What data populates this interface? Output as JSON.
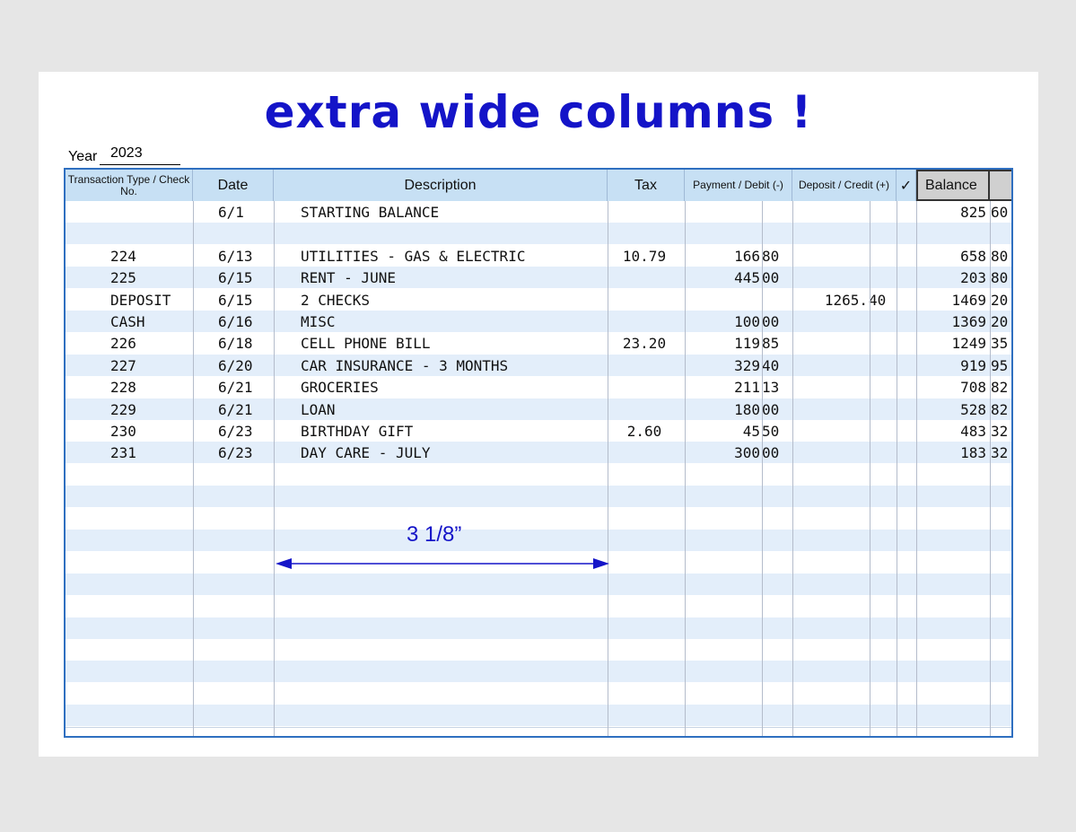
{
  "title": "extra wide columns !",
  "year": {
    "label": "Year",
    "value": "2023"
  },
  "headers": {
    "type": "Transaction Type / Check No.",
    "date": "Date",
    "description": "Description",
    "tax": "Tax",
    "payment": "Payment / Debit (-)",
    "deposit": "Deposit / Credit (+)",
    "check": "✓",
    "balance": "Balance"
  },
  "rows": [
    {
      "type": "",
      "date": "6/1",
      "desc": "STARTING BALANCE",
      "tax": "",
      "pay_d": "",
      "pay_c": "",
      "dep_d": "",
      "dep_c": "",
      "bal_d": "825",
      "bal_c": "60"
    },
    {
      "type": "",
      "date": "",
      "desc": "",
      "tax": "",
      "pay_d": "",
      "pay_c": "",
      "dep_d": "",
      "dep_c": "",
      "bal_d": "",
      "bal_c": ""
    },
    {
      "type": "224",
      "date": "6/13",
      "desc": "UTILITIES - GAS & ELECTRIC",
      "tax": "10.79",
      "pay_d": "166",
      "pay_c": "80",
      "dep_d": "",
      "dep_c": "",
      "bal_d": "658",
      "bal_c": "80"
    },
    {
      "type": "225",
      "date": "6/15",
      "desc": "RENT - JUNE",
      "tax": "",
      "pay_d": "445",
      "pay_c": "00",
      "dep_d": "",
      "dep_c": "",
      "bal_d": "203",
      "bal_c": "80"
    },
    {
      "type": "DEPOSIT",
      "date": "6/15",
      "desc": "2 CHECKS",
      "tax": "",
      "pay_d": "",
      "pay_c": "",
      "dep_d": "1265.",
      "dep_c": "40",
      "bal_d": "1469",
      "bal_c": "20"
    },
    {
      "type": "CASH",
      "date": "6/16",
      "desc": "MISC",
      "tax": "",
      "pay_d": "100",
      "pay_c": "00",
      "dep_d": "",
      "dep_c": "",
      "bal_d": "1369",
      "bal_c": "20"
    },
    {
      "type": "226",
      "date": "6/18",
      "desc": "CELL PHONE BILL",
      "tax": "23.20",
      "pay_d": "119",
      "pay_c": "85",
      "dep_d": "",
      "dep_c": "",
      "bal_d": "1249",
      "bal_c": "35"
    },
    {
      "type": "227",
      "date": "6/20",
      "desc": "CAR INSURANCE - 3 MONTHS",
      "tax": "",
      "pay_d": "329",
      "pay_c": "40",
      "dep_d": "",
      "dep_c": "",
      "bal_d": "919",
      "bal_c": "95"
    },
    {
      "type": "228",
      "date": "6/21",
      "desc": "GROCERIES",
      "tax": "",
      "pay_d": "211",
      "pay_c": "13",
      "dep_d": "",
      "dep_c": "",
      "bal_d": "708",
      "bal_c": "82"
    },
    {
      "type": "229",
      "date": "6/21",
      "desc": "LOAN",
      "tax": "",
      "pay_d": "180",
      "pay_c": "00",
      "dep_d": "",
      "dep_c": "",
      "bal_d": "528",
      "bal_c": "82"
    },
    {
      "type": "230",
      "date": "6/23",
      "desc": "BIRTHDAY GIFT",
      "tax": "2.60",
      "pay_d": "45",
      "pay_c": "50",
      "dep_d": "",
      "dep_c": "",
      "bal_d": "483",
      "bal_c": "32"
    },
    {
      "type": "231",
      "date": "6/23",
      "desc": "DAY CARE - JULY",
      "tax": "",
      "pay_d": "300",
      "pay_c": "00",
      "dep_d": "",
      "dep_c": "",
      "bal_d": "183",
      "bal_c": "32"
    }
  ],
  "empty_row_count": 12,
  "dimension": {
    "label": "3 1/8”"
  },
  "colors": {
    "title": "#1414c8",
    "border": "#2f6fc0",
    "header_bg": "#c7e0f4",
    "alt_row": "#e3eefa",
    "balance_header": "#d0d0d0"
  }
}
